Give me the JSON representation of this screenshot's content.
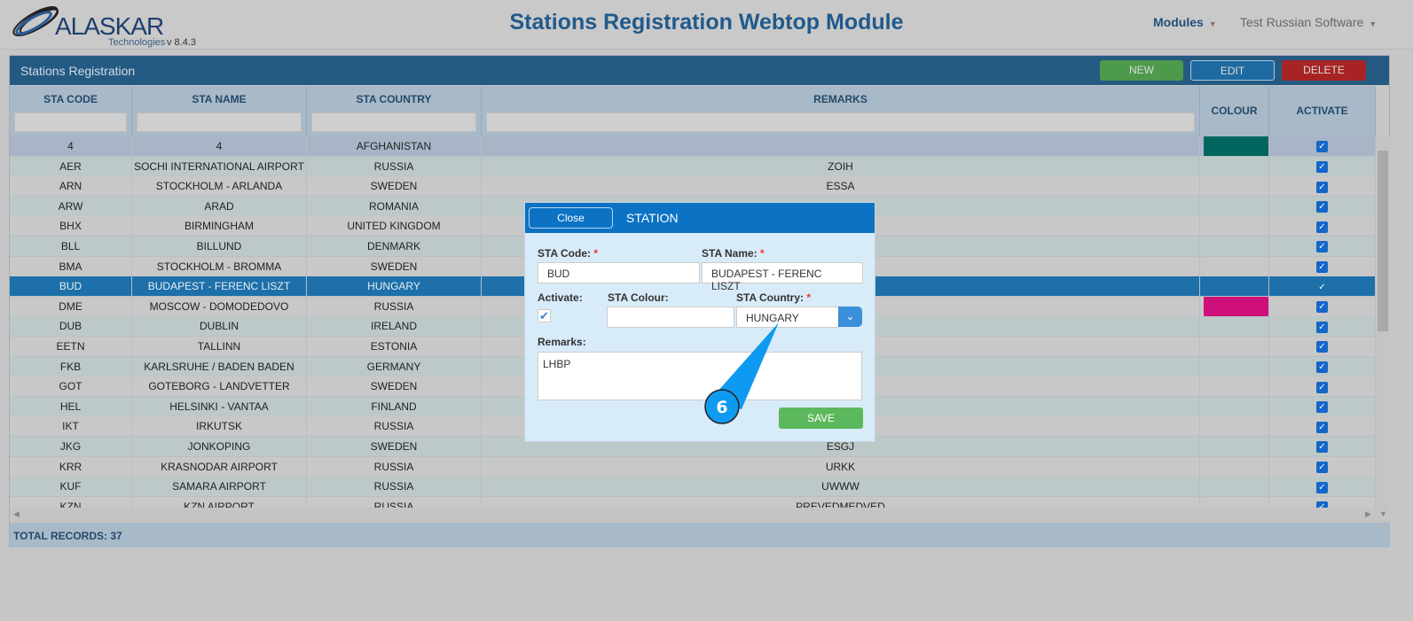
{
  "header": {
    "logo_text": "ALASKAR",
    "logo_sub": "Technologies",
    "version": "v 8.4.3",
    "title": "Stations Registration Webtop Module",
    "modules": "Modules",
    "user": "Test Russian Software"
  },
  "panel": {
    "title": "Stations Registration",
    "new_label": "NEW",
    "edit_label": "EDIT",
    "delete_label": "DELETE",
    "total": "TOTAL RECORDS: 37"
  },
  "columns": [
    "STA CODE",
    "STA NAME",
    "STA COUNTRY",
    "REMARKS",
    "COLOUR",
    "ACTIVATE"
  ],
  "rows": [
    {
      "code": "4",
      "name": "4",
      "country": "AFGHANISTAN",
      "remarks": "",
      "colour": "#00655f",
      "active": true,
      "state": "highlight"
    },
    {
      "code": "AER",
      "name": "SOCHI INTERNATIONAL AIRPORT",
      "country": "RUSSIA",
      "remarks": "ZOIH",
      "colour": "",
      "active": true
    },
    {
      "code": "ARN",
      "name": "STOCKHOLM - ARLANDA",
      "country": "SWEDEN",
      "remarks": "ESSA",
      "colour": "",
      "active": true
    },
    {
      "code": "ARW",
      "name": "ARAD",
      "country": "ROMANIA",
      "remarks": "",
      "colour": "",
      "active": true
    },
    {
      "code": "BHX",
      "name": "BIRMINGHAM",
      "country": "UNITED KINGDOM",
      "remarks": "",
      "colour": "",
      "active": true
    },
    {
      "code": "BLL",
      "name": "BILLUND",
      "country": "DENMARK",
      "remarks": "",
      "colour": "",
      "active": true
    },
    {
      "code": "BMA",
      "name": "STOCKHOLM - BROMMA",
      "country": "SWEDEN",
      "remarks": "",
      "colour": "",
      "active": true
    },
    {
      "code": "BUD",
      "name": "BUDAPEST - FERENC LISZT",
      "country": "HUNGARY",
      "remarks": "",
      "colour": "",
      "active": true,
      "state": "selected"
    },
    {
      "code": "DME",
      "name": "MOSCOW - DOMODEDOVO",
      "country": "RUSSIA",
      "remarks": "",
      "colour": "#d0107a",
      "active": true
    },
    {
      "code": "DUB",
      "name": "DUBLIN",
      "country": "IRELAND",
      "remarks": "",
      "colour": "",
      "active": true
    },
    {
      "code": "EETN",
      "name": "TALLINN",
      "country": "ESTONIA",
      "remarks": "",
      "colour": "",
      "active": true
    },
    {
      "code": "FKB",
      "name": "KARLSRUHE / BADEN BADEN",
      "country": "GERMANY",
      "remarks": "",
      "colour": "",
      "active": true
    },
    {
      "code": "GOT",
      "name": "GOTEBORG - LANDVETTER",
      "country": "SWEDEN",
      "remarks": "",
      "colour": "",
      "active": true
    },
    {
      "code": "HEL",
      "name": "HELSINKI - VANTAA",
      "country": "FINLAND",
      "remarks": "",
      "colour": "",
      "active": true
    },
    {
      "code": "IKT",
      "name": "IRKUTSK",
      "country": "RUSSIA",
      "remarks": "",
      "colour": "",
      "active": true
    },
    {
      "code": "JKG",
      "name": "JONKOPING",
      "country": "SWEDEN",
      "remarks": "ESGJ",
      "colour": "",
      "active": true
    },
    {
      "code": "KRR",
      "name": "KRASNODAR AIRPORT",
      "country": "RUSSIA",
      "remarks": "URKK",
      "colour": "",
      "active": true
    },
    {
      "code": "KUF",
      "name": "SAMARA AIRPORT",
      "country": "RUSSIA",
      "remarks": "UWWW",
      "colour": "",
      "active": true
    },
    {
      "code": "KZN",
      "name": "KZN AIRPORT",
      "country": "RUSSIA",
      "remarks": "PREVEDMEDVED",
      "colour": "",
      "active": true
    }
  ],
  "modal": {
    "close_label": "Close",
    "title": "STATION",
    "code_label": "STA Code:",
    "code_value": "BUD",
    "name_label": "STA Name:",
    "name_value": "BUDAPEST - FERENC LISZT",
    "activate_label": "Activate:",
    "activate_checked": true,
    "colour_label": "STA Colour:",
    "colour_value": "",
    "country_label": "STA Country:",
    "country_value": "HUNGARY",
    "remarks_label": "Remarks:",
    "remarks_value": "LHBP",
    "save_label": "SAVE",
    "required_mark": "*"
  },
  "callout": {
    "number": "6",
    "color": "#0e9af0"
  }
}
